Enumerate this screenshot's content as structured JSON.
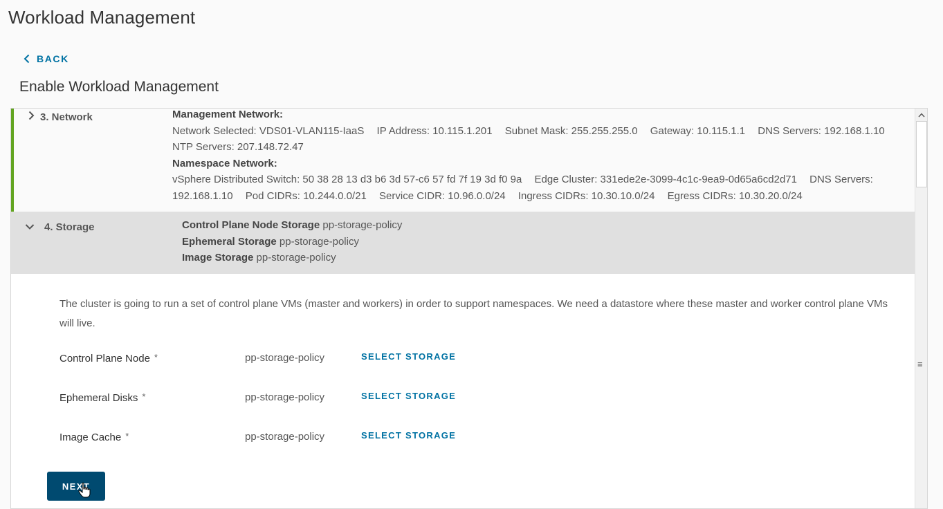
{
  "page": {
    "title": "Workload Management"
  },
  "back": {
    "label": "BACK"
  },
  "wizard": {
    "title": "Enable Workload Management"
  },
  "network_step": {
    "label": "3. Network",
    "mgmt_heading": "Management Network:",
    "mgmt_items": [
      "Network Selected: VDS01-VLAN115-IaaS",
      "IP Address: 10.115.1.201",
      "Subnet Mask: 255.255.255.0",
      "Gateway: 10.115.1.1",
      "DNS Servers: 192.168.1.10",
      "NTP Servers: 207.148.72.47"
    ],
    "ns_heading": "Namespace Network:",
    "ns_items": [
      "vSphere Distributed Switch: 50 38 28 13 d3 b6 3d 57-c6 57 fd 7f 19 3d f0 9a",
      "Edge Cluster: 331ede2e-3099-4c1c-9ea9-0d65a6cd2d71",
      "DNS Servers: 192.168.1.10",
      "Pod CIDRs: 10.244.0.0/21",
      "Service CIDR: 10.96.0.0/24",
      "Ingress CIDRs: 10.30.10.0/24",
      "Egress CIDRs: 10.30.20.0/24"
    ]
  },
  "storage_step": {
    "label": "4. Storage",
    "summary": [
      {
        "key": "Control Plane Node Storage",
        "value": "pp-storage-policy"
      },
      {
        "key": "Ephemeral Storage",
        "value": "pp-storage-policy"
      },
      {
        "key": "Image Storage",
        "value": "pp-storage-policy"
      }
    ],
    "description": "The cluster is going to run a set of control plane VMs (master and workers) in order to support namespaces. We need a datastore where these master and worker control plane VMs will live.",
    "rows": [
      {
        "label": "Control Plane Node",
        "required": "*",
        "value": "pp-storage-policy",
        "action": "SELECT STORAGE"
      },
      {
        "label": "Ephemeral Disks",
        "required": "*",
        "value": "pp-storage-policy",
        "action": "SELECT STORAGE"
      },
      {
        "label": "Image Cache",
        "required": "*",
        "value": "pp-storage-policy",
        "action": "SELECT STORAGE"
      }
    ],
    "next_label": "NEXT"
  },
  "icons": {
    "back": "chevron-left-icon",
    "network_toggle": "chevron-right-icon",
    "storage_toggle": "chevron-down-icon",
    "scroll_up": "arrow-up-icon",
    "scroll_grip": "grip-icon",
    "cursor": "hand-pointer-icon"
  },
  "colors": {
    "accent_link": "#0072a3",
    "primary_button": "#004a70",
    "complete_step_border": "#62a420",
    "active_step_bg": "#e0e0e0"
  }
}
